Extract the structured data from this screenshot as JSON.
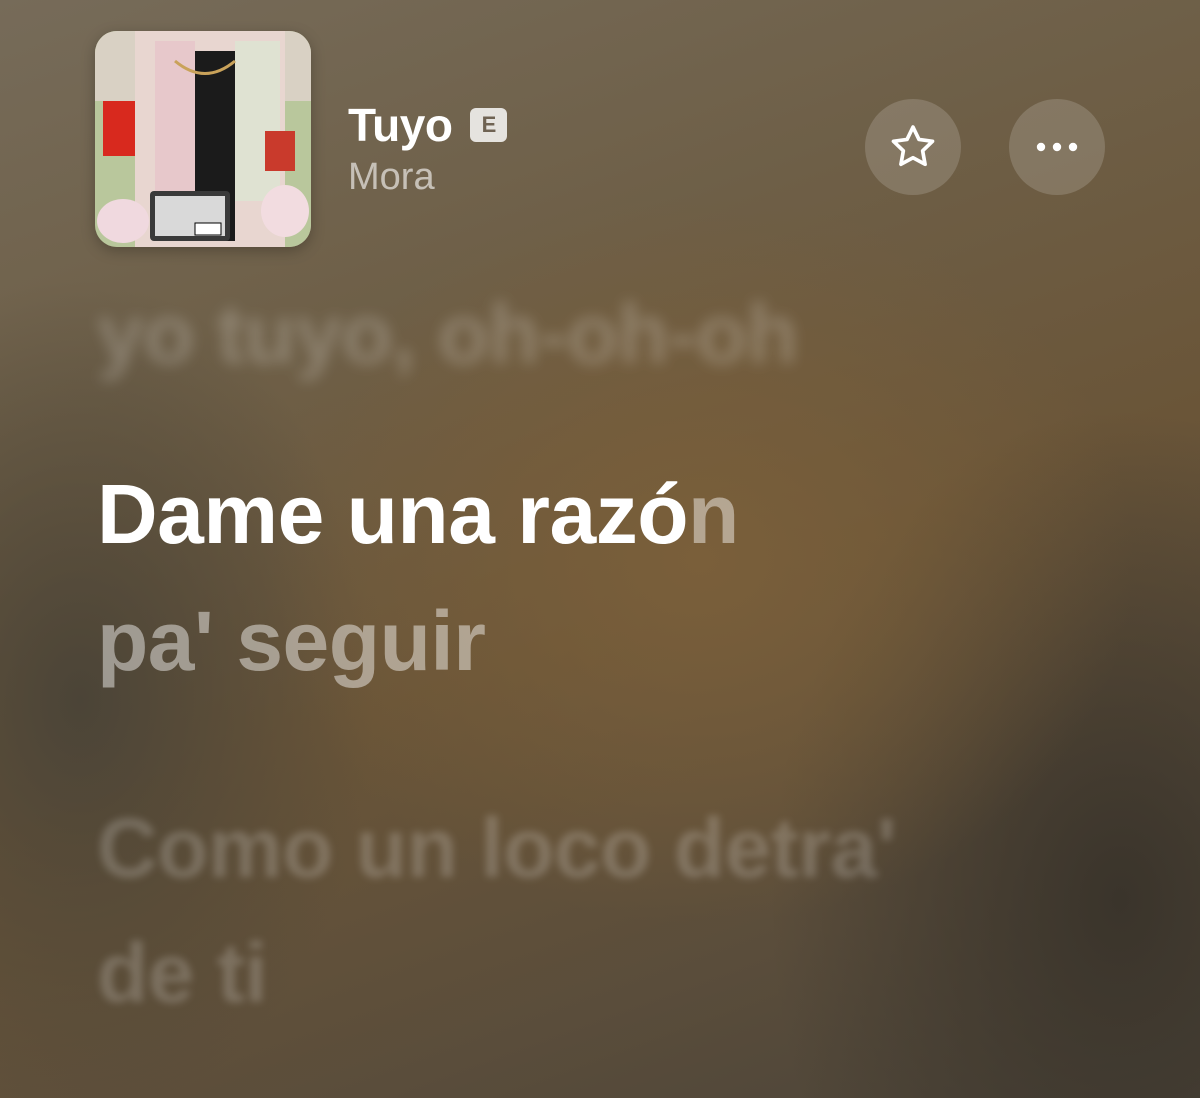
{
  "track": {
    "title": "Tuyo",
    "explicit_badge": "E",
    "artist": "Mora"
  },
  "actions": {
    "favorite_icon": "star-icon",
    "more_icon": "ellipsis-icon"
  },
  "lyrics": {
    "previous_line": "yo tuyo, oh-oh-oh",
    "current_line_sung": "Dame una razó",
    "current_line_unsung": "n",
    "current_line_2": "pa' seguir",
    "next_line": "Como un loco detra'",
    "next_line_2": "de ti"
  },
  "colors": {
    "background_accent": "#6a5538",
    "lyric_active": "#ffffff"
  }
}
